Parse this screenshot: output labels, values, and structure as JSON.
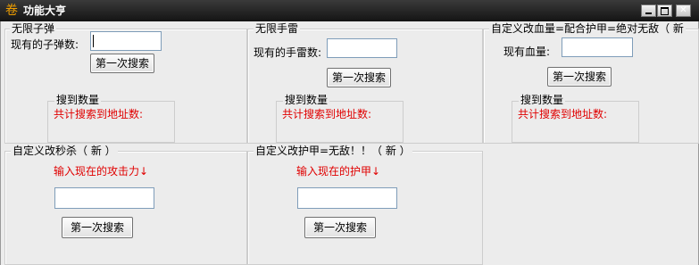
{
  "window": {
    "title": "功能大亨",
    "icon": "app-logo-icon"
  },
  "panel_grenade_ammo": {
    "title": "无限子弹",
    "current_label": "现有的子弹数:",
    "current_value": "",
    "search_button": "第一次搜索",
    "results_title": "搜到数量",
    "results_label": "共计搜索到地址数:"
  },
  "panel_grenades": {
    "title": "无限手雷",
    "current_label": "现有的手雷数:",
    "current_value": "",
    "search_button": "第一次搜索",
    "results_title": "搜到数量",
    "results_label": "共计搜索到地址数:"
  },
  "panel_health": {
    "title": "自定义改血量=配合护甲=绝对无敌（    新",
    "current_label": "现有血量:",
    "current_value": "",
    "search_button": "第一次搜索",
    "results_title": "搜到数量",
    "results_label": "共计搜索到地址数:"
  },
  "panel_oneshot": {
    "title": "自定义改秒杀（    新    ）",
    "prompt": "输入现在的攻击力↓",
    "current_value": "",
    "search_button": "第一次搜索"
  },
  "panel_armor": {
    "title": "自定义改护甲=无敌！！（    新    ）",
    "prompt": "输入现在的护甲↓",
    "current_value": "",
    "search_button": "第一次搜索"
  }
}
